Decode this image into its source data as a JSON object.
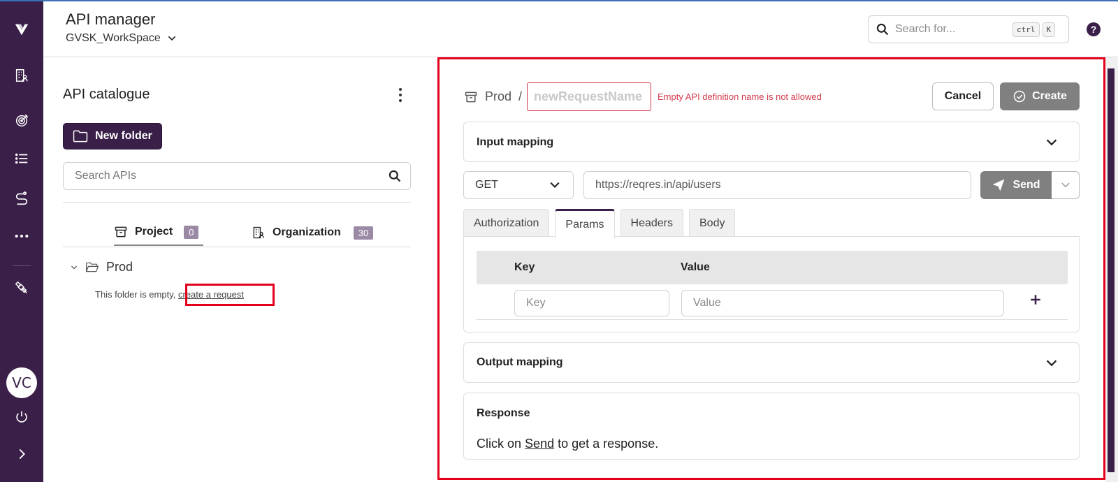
{
  "header": {
    "app_title": "API manager",
    "workspace": "GVSK_WorkSpace",
    "search_placeholder": "Search for...",
    "shortcut_keys": [
      "ctrl",
      "K"
    ],
    "help": "?"
  },
  "sidebar": {
    "icons": [
      "logo-icon",
      "organization-icon",
      "target-icon",
      "list-icon",
      "route-icon",
      "more-icon",
      "satellite-icon",
      "power-icon",
      "expand-icon"
    ],
    "avatar_initials": "VC"
  },
  "catalogue": {
    "title": "API catalogue",
    "new_folder_label": "New folder",
    "search_placeholder": "Search APIs",
    "tabs": [
      {
        "label": "Project",
        "count": "0"
      },
      {
        "label": "Organization",
        "count": "30"
      }
    ],
    "folder_name": "Prod",
    "empty_text": "This folder is empty,",
    "create_request_link": "create a request"
  },
  "request": {
    "breadcrumb_folder": "Prod",
    "breadcrumb_sep": "/",
    "name_placeholder": "newRequestName",
    "error_message": "Empty API definition name is not allowed",
    "cancel_label": "Cancel",
    "create_label": "Create",
    "input_mapping_label": "Input mapping",
    "method": "GET",
    "url": "https://reqres.in/api/users",
    "send_label": "Send",
    "tabs": [
      "Authorization",
      "Params",
      "Headers",
      "Body"
    ],
    "active_tab": "Params",
    "params": {
      "key_header": "Key",
      "value_header": "Value",
      "key_placeholder": "Key",
      "value_placeholder": "Value"
    },
    "output_mapping_label": "Output mapping",
    "response_title": "Response",
    "response_prefix": "Click on",
    "response_link": "Send",
    "response_suffix": "to get a response."
  },
  "colors": {
    "brand": "#3a1f48",
    "error": "#d33a4a",
    "highlight": "#e4001b",
    "disabled_button": "#808080"
  }
}
